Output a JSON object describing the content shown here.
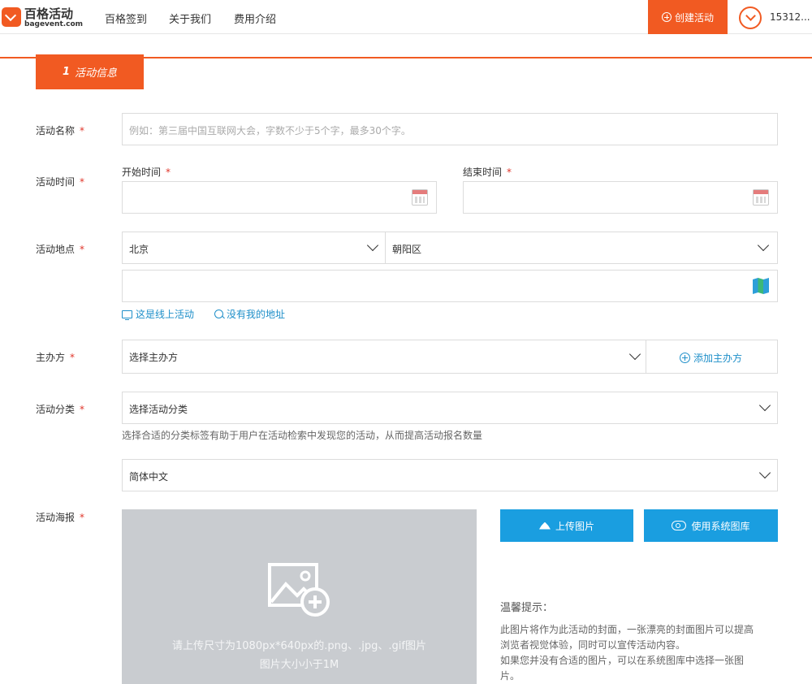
{
  "header": {
    "logo_title": "百格活动",
    "logo_sub": "bagevent.com",
    "nav": [
      "百格签到",
      "关于我们",
      "费用介绍"
    ],
    "create_label": "创建活动",
    "user_name": "15312..."
  },
  "step": {
    "number": "1",
    "label": "活动信息"
  },
  "form": {
    "name": {
      "label": "活动名称",
      "required": "*",
      "placeholder": "例如：第三届中国互联网大会，字数不少于5个字，最多30个字。"
    },
    "time": {
      "label": "活动时间",
      "required": "*",
      "start_label": "开始时间",
      "end_label": "结束时间"
    },
    "location": {
      "label": "活动地点",
      "required": "*",
      "city": "北京",
      "district": "朝阳区",
      "online_link": "这是线上活动",
      "no_address_link": "没有我的地址"
    },
    "organizer": {
      "label": "主办方",
      "required": "*",
      "select_value": "选择主办方",
      "add_label": "添加主办方"
    },
    "category": {
      "label": "活动分类",
      "required": "*",
      "select_value": "选择活动分类",
      "hint": "选择合适的分类标签有助于用户在活动检索中发现您的活动，从而提高活动报名数量"
    },
    "language": {
      "select_value": "简体中文"
    },
    "poster": {
      "label": "活动海报",
      "required": "*",
      "upload_hint_line1": "请上传尺寸为1080px*640px的.png、.jpg、.gif图片",
      "upload_hint_line2": "图片大小小于1M",
      "upload_button": "上传图片",
      "gallery_button": "使用系统图库",
      "tip_title": "温馨提示：",
      "tip_lines": [
        "此图片将作为此活动的封面，一张漂亮的封面图片可以提高",
        "浏览者视觉体验，同时可以宣传活动内容。",
        "如果您并没有合适的图片，可以在系统图库中选择一张图",
        "片。"
      ]
    }
  },
  "colors": {
    "brand": "#f15a22",
    "accent_blue": "#1a9ee0",
    "required": "#e0352a"
  }
}
